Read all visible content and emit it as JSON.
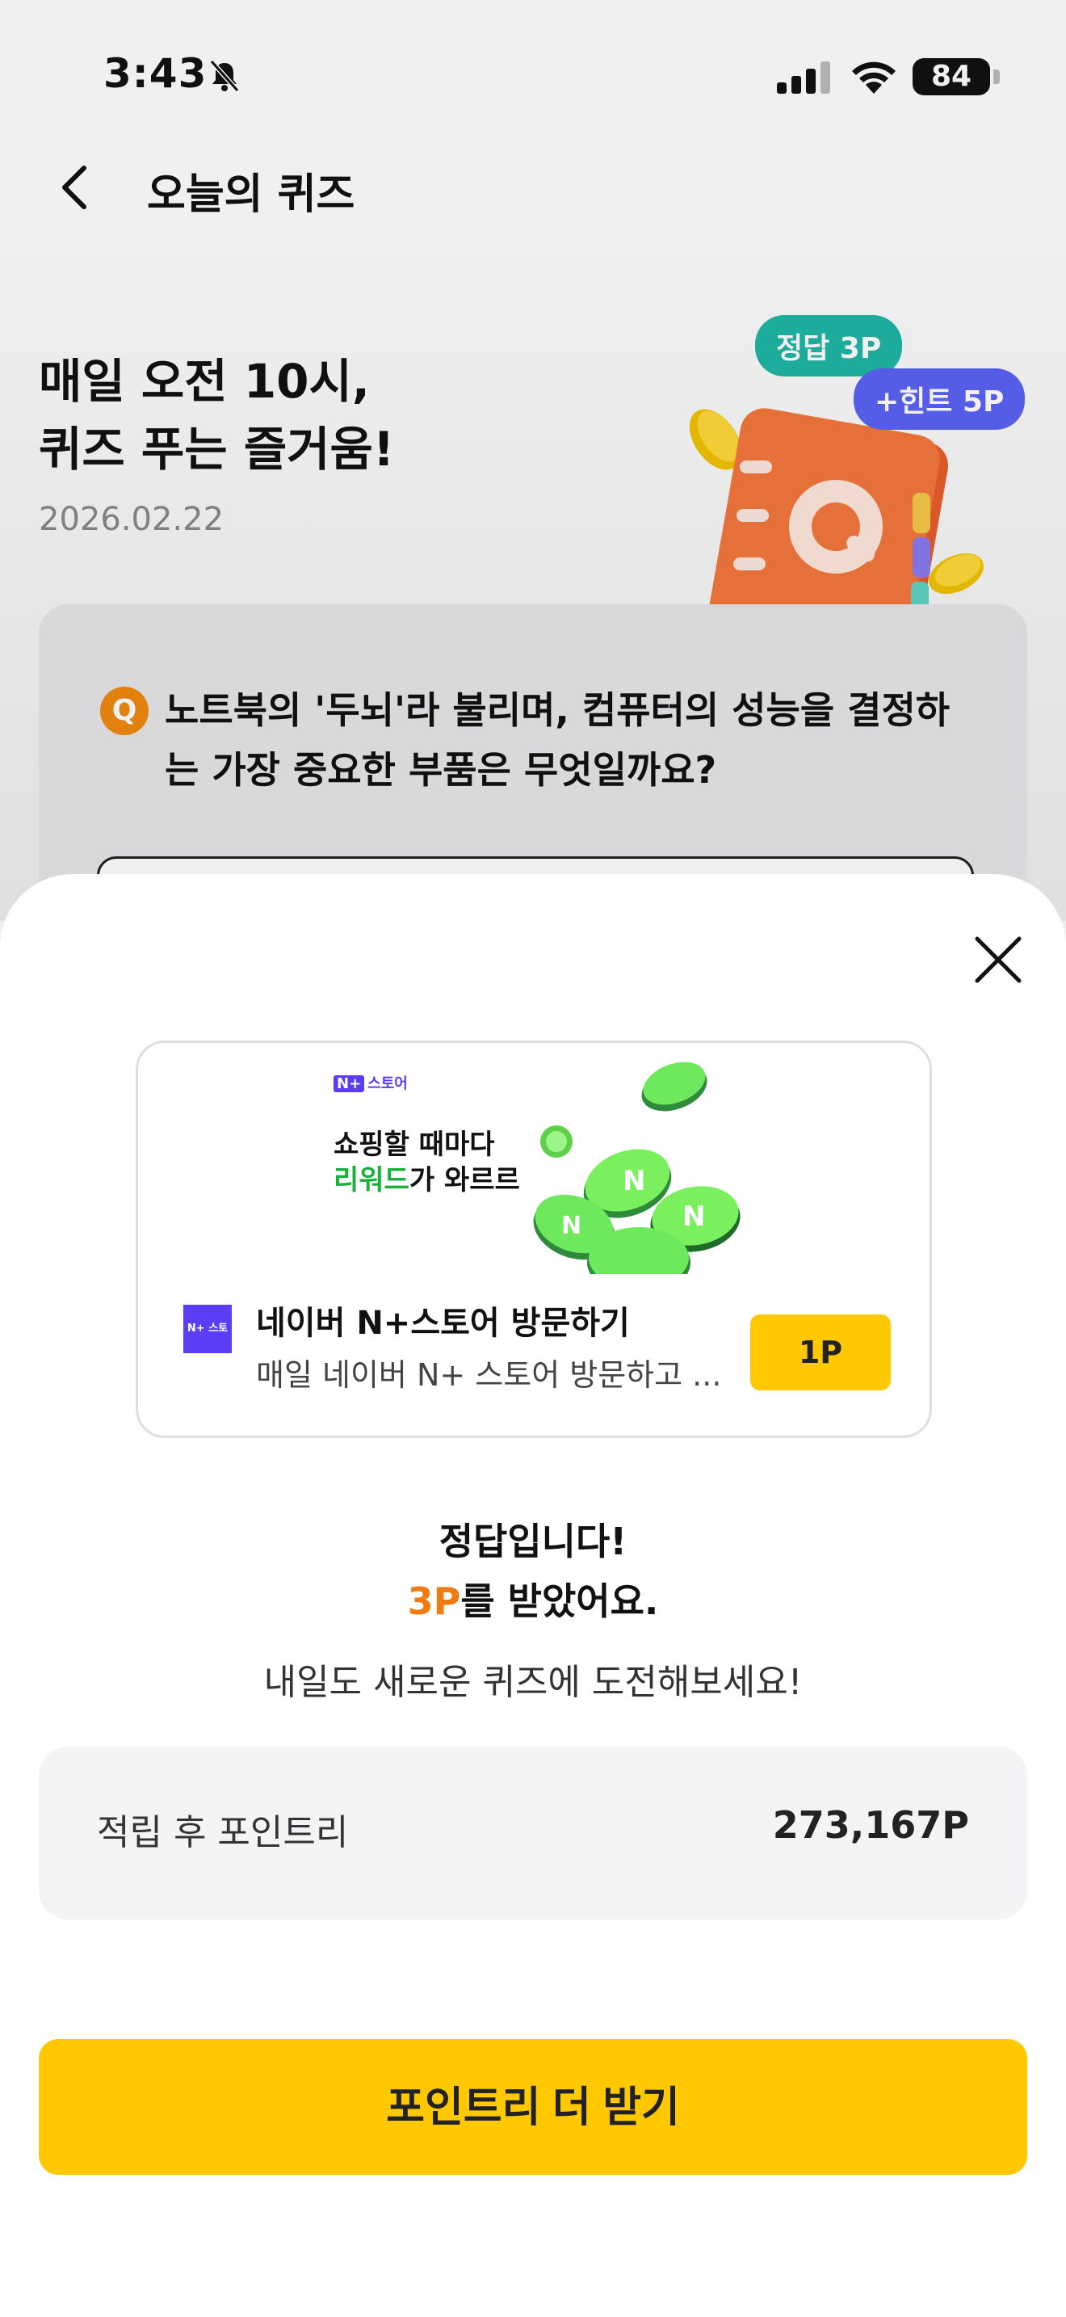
{
  "status_bar": {
    "time": "3:43",
    "battery": "84"
  },
  "header": {
    "title": "오늘의 퀴즈"
  },
  "hero": {
    "title_line1": "매일 오전 10시,",
    "title_line2": "퀴즈 푸는 즐거움!",
    "date": "2026.02.22",
    "badge_correct": "정답 3P",
    "badge_hint": "+힌트 5P",
    "icon": "quiz-notebook-icon"
  },
  "question": {
    "badge": "Q",
    "text": "노트북의 '두뇌'라 불리며, 컴퓨터의 성능을 결정하는 가장 중요한 부품은 무엇일까요?"
  },
  "ad": {
    "brand": "스토어",
    "brand_badge": "N+",
    "headline_line1_bold": "쇼핑",
    "headline_line1_rest": "할 때마다",
    "headline_line2_green": "리워드",
    "headline_line2_rest": "가 와르르",
    "logo_text": "N+ 스토어",
    "title": "네이버 N+스토어 방문하기",
    "description": "매일 네이버 N+ 스토어 방문하고 ...",
    "button_label": "1P"
  },
  "result": {
    "line1": "정답입니다!",
    "points": "3P",
    "line2_rest": "를 받았어요.",
    "line3": "내일도 새로운 퀴즈에 도전해보세요!"
  },
  "balance": {
    "label": "적립 후 포인트리",
    "value": "273,167P"
  },
  "cta": {
    "label": "포인트리 더 받기"
  },
  "colors": {
    "accent_yellow": "#ffc800",
    "points_orange": "#f07b10",
    "badge_green": "#1fb7a6",
    "badge_purple": "#5b63f5"
  }
}
